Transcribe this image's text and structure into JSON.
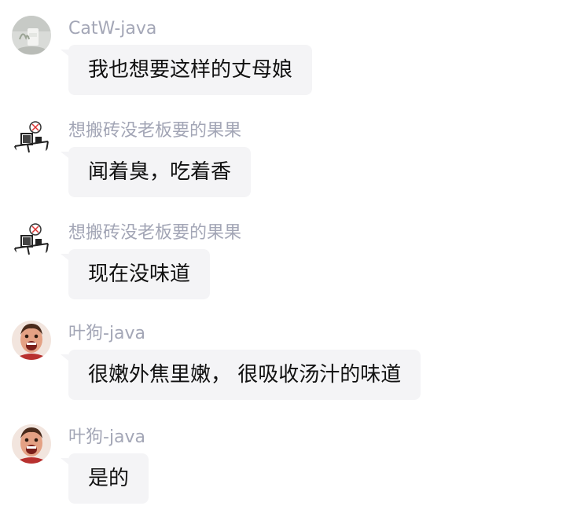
{
  "messages": [
    {
      "avatar_icon": "cat-plant-avatar-icon",
      "sender": "CatW-java",
      "text": "我也想要这样的丈母娘"
    },
    {
      "avatar_icon": "desk-sketch-avatar-icon",
      "sender": "想搬砖没老板要的果果",
      "text": "闻着臭，吃着香"
    },
    {
      "avatar_icon": "desk-sketch-avatar-icon",
      "sender": "想搬砖没老板要的果果",
      "text": "现在没味道"
    },
    {
      "avatar_icon": "laughing-man-avatar-icon",
      "sender": "叶狗-java",
      "text": "很嫩外焦里嫩， 很吸收汤汁的味道"
    },
    {
      "avatar_icon": "laughing-man-avatar-icon",
      "sender": "叶狗-java",
      "text": "是的"
    }
  ],
  "colors": {
    "sender_name": "#a3a6b6",
    "bubble_background": "#f4f4f6",
    "message_text": "#111111"
  }
}
